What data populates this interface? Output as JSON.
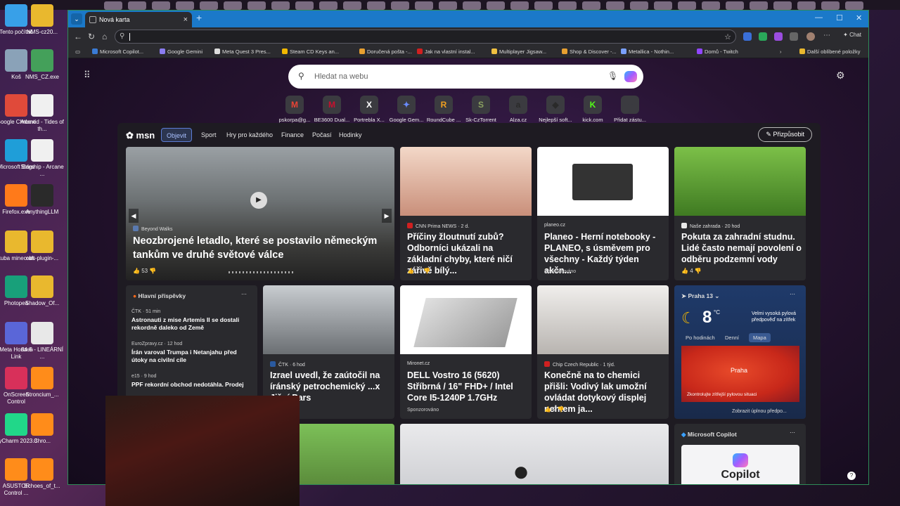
{
  "desktop": {
    "icons": [
      {
        "label": "Tento počítač",
        "color": "#38a0e8"
      },
      {
        "label": "NMS-cz20...",
        "color": "#e9b82e"
      },
      {
        "label": "Koš",
        "color": "#8aa2b8"
      },
      {
        "label": "NMS_CZ.exe",
        "color": "#44a05a"
      },
      {
        "label": "Google Chrome",
        "color": "#e04a3a"
      },
      {
        "label": "Atlantid - Tides of th...",
        "color": "#f0f0f0"
      },
      {
        "label": "Microsoft Edge",
        "color": "#1f9ed8"
      },
      {
        "label": "Starship - Arcane ...",
        "color": "#f0f0f0"
      },
      {
        "label": "Firefox.exe",
        "color": "#ff7a1a"
      },
      {
        "label": "AnythingLLM",
        "color": "#2a2a2a"
      },
      {
        "label": "kuba minecraft",
        "color": "#e9b82e"
      },
      {
        "label": "obs-plugin-...",
        "color": "#e9b82e"
      },
      {
        "label": "Photopea",
        "color": "#18a07a"
      },
      {
        "label": "Shadow_Of...",
        "color": "#e9b82e"
      },
      {
        "label": "Meta Horizon Link",
        "color": "#5a66d8"
      },
      {
        "label": "84-5 - LINEÁRNÍ ...",
        "color": "#e8e8e8"
      },
      {
        "label": "OnScreen Control",
        "color": "#d8305a"
      },
      {
        "label": "Stroncium_...",
        "color": "#ff8c1a"
      },
      {
        "label": "PyCharm 2023.3",
        "color": "#21d789"
      },
      {
        "label": "Chro...",
        "color": "#ff8c1a"
      },
      {
        "label": "ASUSTOR Control ...",
        "color": "#ff8c1a"
      },
      {
        "label": "Echoes_of_t...",
        "color": "#ff8c1a"
      }
    ]
  },
  "browser": {
    "tab_title": "Nová karta",
    "address_value": "",
    "chat_label": "Chat",
    "bookmarks": [
      {
        "label": "Microsoft Copilot...",
        "color": "#3a7bd5"
      },
      {
        "label": "Google Gemini",
        "color": "#8a7cf0"
      },
      {
        "label": "Meta Quest 3 Pres...",
        "color": "#dddddd"
      },
      {
        "label": "Steam CD Keys an...",
        "color": "#f2b800"
      },
      {
        "label": "Doručená pošta -...",
        "color": "#e8a030"
      },
      {
        "label": "Jak na vlastní instal...",
        "color": "#d02020"
      },
      {
        "label": "Multiplayer Jigsaw...",
        "color": "#f0c040"
      },
      {
        "label": "Shop & Discover -...",
        "color": "#e8a030"
      },
      {
        "label": "Metallica - Nothin...",
        "color": "#7aa0ff"
      },
      {
        "label": "Domů - Twitch",
        "color": "#9146ff"
      }
    ],
    "more_bookmarks": "Další oblíbené položky"
  },
  "newtab": {
    "search_placeholder": "Hledat na webu",
    "quick_links": [
      {
        "label": "pskorpa@g...",
        "glyph": "M",
        "color": "#ea4335"
      },
      {
        "label": "BE3600 Dual...",
        "glyph": "M",
        "color": "#c8102e"
      },
      {
        "label": "Portrebla X...",
        "glyph": "X",
        "color": "#000000"
      },
      {
        "label": "Google Gem...",
        "glyph": "✦",
        "color": "#6a8cff"
      },
      {
        "label": "RoundCube ...",
        "glyph": "R",
        "color": "#f0a020"
      },
      {
        "label": "Sk-CzTorrent",
        "glyph": "S",
        "color": "#8aa060"
      },
      {
        "label": "Alza.cz",
        "glyph": "a",
        "color": "#2a2a2a"
      },
      {
        "label": "Nejlepší soft...",
        "glyph": "◆",
        "color": "#2a2a2a"
      },
      {
        "label": "kick.com",
        "glyph": "K",
        "color": "#53fc18"
      },
      {
        "label": "Přidat zástu...",
        "glyph": "+",
        "color": "#3b3b40"
      }
    ]
  },
  "msn": {
    "logo": "msn",
    "nav": [
      "Objevit",
      "Sport",
      "Hry pro každého",
      "Finance",
      "Počasí",
      "Hodinky"
    ],
    "customize": "Přizpůsobit",
    "hero": {
      "source": "Beyond Walks",
      "title": "Neozbrojené letadlo, které se postavilo německým tankům ve druhé světové válce",
      "likes": "53"
    },
    "cards": [
      {
        "source": "CNN Prima NEWS · 2 d.",
        "title": "Příčiny žloutnutí zubů? Odborníci ukázali na základní chyby, které ničí zářivě bílý...",
        "likes": "13"
      },
      {
        "source": "planeo.cz",
        "title": "Planeo - Herní notebooky - PLANEO, s úsměvem pro všechny - Každý týden akčn...",
        "sponsored": "Sponzorováno"
      },
      {
        "source": "Naše zahrada · 20 hod",
        "title": "Pokuta za zahradní studnu. Lidé často nemají povolení o odběru podzemní vody",
        "likes": "4"
      },
      {
        "source": "ČTK · 6 hod",
        "title": "Izrael uvedl, že zaútočil na íránský petrochemický ...x Jižní Pars"
      },
      {
        "source": "Mironet.cz",
        "title": "DELL Vostro 16 (5620) Stříbrná / 16\" FHD+ / Intel Core I5-1240P 1.7GHz",
        "sponsored": "Sponzorováno"
      },
      {
        "source": "Chip Czech Republic · 1 týd.",
        "title": "Konečně na to chemici přišli: Vodivý lak umožní ovládat dotykový displej nehtem ja...",
        "likes": "2"
      }
    ],
    "headlines": {
      "heading": "Hlavní příspěvky",
      "items": [
        {
          "source": "ČTK · 51 min",
          "title": "Astronauti z mise Artemis II se dostali rekordně daleko od Země"
        },
        {
          "source": "EuroZpravy.cz · 12 hod",
          "title": "Írán varoval Trumpa i Netanjahu před útoky na civilní cíle"
        },
        {
          "source": "e15 · 9 hod",
          "title": "PPF rekordní obchod nedotáhla. Prodej"
        }
      ]
    },
    "weather": {
      "city": "Praha 13",
      "temp": "8",
      "unit": "°C",
      "alert": "Velmi vysoká pylová předpověď na zítřek",
      "tabs": [
        "Po hodinách",
        "Denní",
        "Mapa"
      ],
      "map_label": "Praha",
      "map_note": "Zkontrolujte zítřejší pylovou situaci",
      "footer": "Zobrazit úplnou předpo..."
    },
    "copilot": {
      "heading": "Microsoft Copilot",
      "text": "Copilot"
    }
  }
}
